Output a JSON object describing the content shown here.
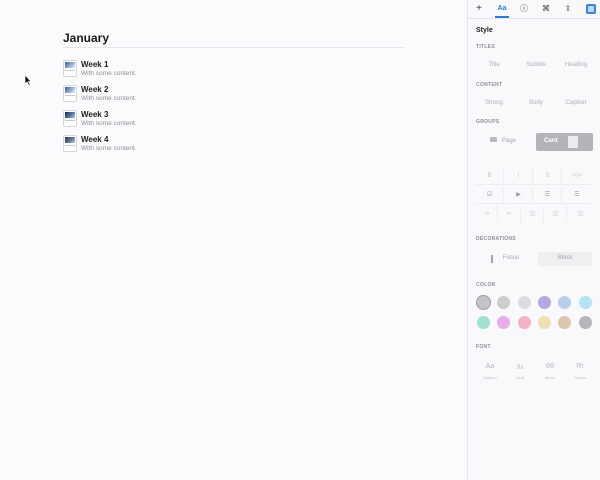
{
  "document": {
    "title": "January",
    "rows": [
      {
        "title": "Week 1",
        "subtitle": "With some content."
      },
      {
        "title": "Week 2",
        "subtitle": "With some content."
      },
      {
        "title": "Week 3",
        "subtitle": "With some content."
      },
      {
        "title": "Week 4",
        "subtitle": "With some content."
      }
    ]
  },
  "toolbar": {
    "add": "+",
    "style_tab": "Aa",
    "info": "ⓘ",
    "command": "⌘",
    "share": "⇪",
    "icons": [
      "plus-icon",
      "style-icon",
      "info-icon",
      "command-icon",
      "share-icon",
      "app-icon"
    ]
  },
  "sidebar": {
    "heading": "Style",
    "titles": {
      "label": "TITLES",
      "options": [
        "Title",
        "Subtitle",
        "Heading"
      ]
    },
    "content": {
      "label": "CONTENT",
      "options": [
        "Strong",
        "Body",
        "Caption"
      ]
    },
    "groups": {
      "label": "GROUPS",
      "page": "Page",
      "card": "Card",
      "selected": "Card"
    },
    "format_grid": [
      [
        "B",
        "I",
        "S",
        "</>"
      ],
      [
        "☑",
        "▶",
        "☰",
        "☰"
      ],
      [
        "⇥",
        "⇤",
        "◫",
        "◫",
        "◫"
      ]
    ],
    "decorations": {
      "label": "DECORATIONS",
      "focus": "Focus",
      "block": "Block"
    },
    "color": {
      "label": "COLOR",
      "swatches": [
        "#b9b9be",
        "#c4c4c8",
        "#d6d6da",
        "#a79ad8",
        "#a9c4ea",
        "#a8e0ef",
        "#8fdcc7",
        "#e59be7",
        "#f0a6bb",
        "#ecd9a3",
        "#d8bb9f",
        "#a9a9ae"
      ],
      "selected_index": 0
    },
    "font": {
      "label": "FONT",
      "options": [
        {
          "glyph": "Aa",
          "name": "System"
        },
        {
          "glyph": "Ss",
          "name": "Serif"
        },
        {
          "glyph": "00",
          "name": "Mono"
        },
        {
          "glyph": "Rr",
          "name": "Round"
        }
      ]
    }
  }
}
